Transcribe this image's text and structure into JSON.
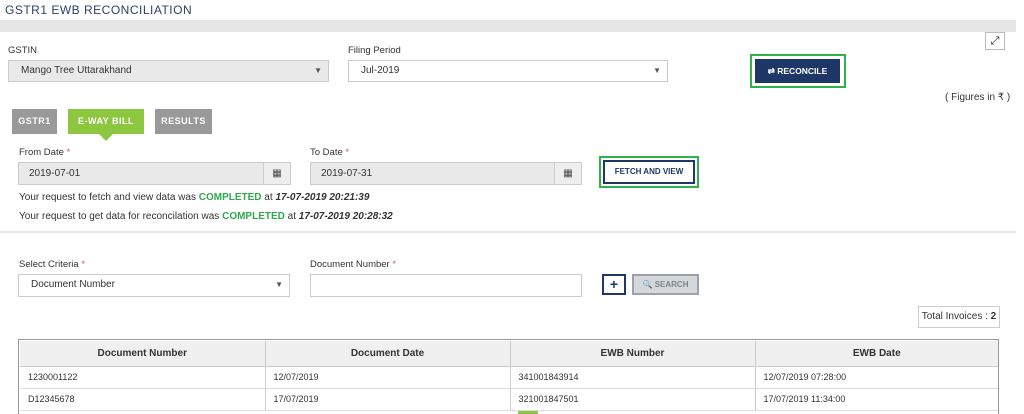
{
  "page": {
    "title": "GSTR1 EWB RECONCILIATION"
  },
  "header": {
    "gstin_label": "GSTIN",
    "gstin_value": "Mango Tree Uttarakhand",
    "filing_period_label": "Filing Period",
    "filing_period_value": "Jul-2019",
    "reconcile_label": "⇄ RECONCILE",
    "figures_note": "( Figures in ₹ )"
  },
  "tabs": [
    {
      "label": "GSTR1",
      "active": false
    },
    {
      "label": "E-WAY BILL",
      "active": true
    },
    {
      "label": "RESULTS",
      "active": false
    }
  ],
  "fetch": {
    "from_date_label": "From Date",
    "from_date_value": "2019-07-01",
    "to_date_label": "To Date",
    "to_date_value": "2019-07-31",
    "fetch_button_label": "FETCH AND VIEW",
    "required_mark": "*"
  },
  "messages": [
    {
      "prefix": "Your request to fetch and view data was ",
      "status": "COMPLETED",
      "mid": " at ",
      "timestamp": "17-07-2019 20:21:39"
    },
    {
      "prefix": "Your request to get data for reconcilation was ",
      "status": "COMPLETED",
      "mid": " at ",
      "timestamp": "17-07-2019 20:28:32"
    }
  ],
  "search": {
    "criteria_label": "Select Criteria",
    "criteria_value": "Document Number",
    "doc_number_label": "Document Number",
    "doc_number_value": "",
    "add_label": "+",
    "search_label": "🔍 SEARCH"
  },
  "summary": {
    "total_label": "Total Invoices : ",
    "total_value": "2"
  },
  "table": {
    "columns": [
      "Document Number",
      "Document Date",
      "EWB Number",
      "EWB Date"
    ],
    "rows": [
      [
        "1230001122",
        "12/07/2019",
        "341001843914",
        "12/07/2019 07:28:00"
      ],
      [
        "D12345678",
        "17/07/2019",
        "321001847501",
        "17/07/2019 11:34:00"
      ]
    ]
  },
  "colors": {
    "accent_green": "#2fb24a",
    "navy": "#1f3766",
    "tab_green": "#8dc63f",
    "tab_gray": "#999999",
    "status_green": "#2fa84f"
  },
  "icons": [
    "expand-icon",
    "dropdown-caret-icon",
    "calendar-icon",
    "swap-arrows-icon",
    "plus-icon",
    "search-icon"
  ]
}
